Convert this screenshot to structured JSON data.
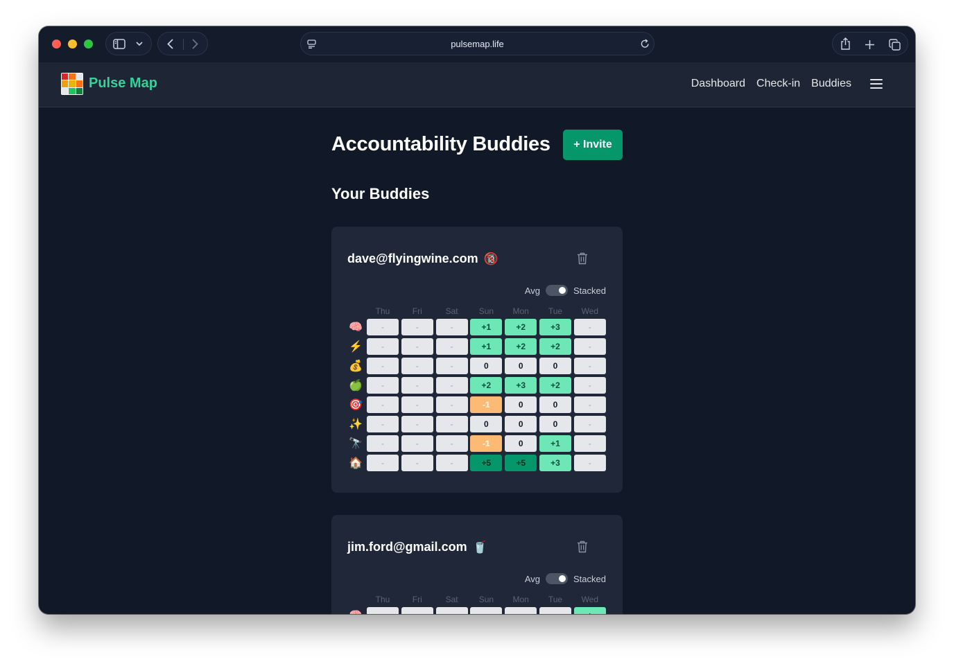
{
  "browser": {
    "url": "pulsemap.life"
  },
  "app": {
    "brand": "Pulse Map",
    "nav": [
      "Dashboard",
      "Check-in",
      "Buddies"
    ],
    "logo_colors": [
      "#dc2626",
      "#f97316",
      "#e5e7eb",
      "#f59e0b",
      "#eab308",
      "#f97316",
      "#e5e7eb",
      "#22c55e",
      "#15803d"
    ]
  },
  "page": {
    "title": "Accountability Buddies",
    "invite_label": "+ Invite",
    "section_title": "Your Buddies"
  },
  "days": [
    "Thu",
    "Fri",
    "Sat",
    "Sun",
    "Mon",
    "Tue",
    "Wed"
  ],
  "toggle": {
    "left": "Avg",
    "right": "Stacked"
  },
  "buddies": [
    {
      "email": "dave@flyingwine.com",
      "status_emoji": "🔞",
      "rows": [
        {
          "emoji": "🧠",
          "values": [
            "-",
            "-",
            "-",
            "+1",
            "+2",
            "+3",
            "-"
          ]
        },
        {
          "emoji": "⚡",
          "values": [
            "-",
            "-",
            "-",
            "+1",
            "+2",
            "+2",
            "-"
          ]
        },
        {
          "emoji": "💰",
          "values": [
            "-",
            "-",
            "-",
            "0",
            "0",
            "0",
            "-"
          ]
        },
        {
          "emoji": "🍏",
          "values": [
            "-",
            "-",
            "-",
            "+2",
            "+3",
            "+2",
            "-"
          ]
        },
        {
          "emoji": "🎯",
          "values": [
            "-",
            "-",
            "-",
            "-1",
            "0",
            "0",
            "-"
          ]
        },
        {
          "emoji": "✨",
          "values": [
            "-",
            "-",
            "-",
            "0",
            "0",
            "0",
            "-"
          ]
        },
        {
          "emoji": "🔭",
          "values": [
            "-",
            "-",
            "-",
            "-1",
            "0",
            "+1",
            "-"
          ]
        },
        {
          "emoji": "🏠",
          "values": [
            "-",
            "-",
            "-",
            "+5",
            "+5",
            "+3",
            "-"
          ]
        }
      ]
    },
    {
      "email": "jim.ford@gmail.com",
      "status_emoji": "🥤",
      "rows": [
        {
          "emoji": "🧠",
          "values": [
            "-",
            "-",
            "-",
            "-",
            "-",
            "-",
            "+"
          ]
        }
      ]
    }
  ]
}
